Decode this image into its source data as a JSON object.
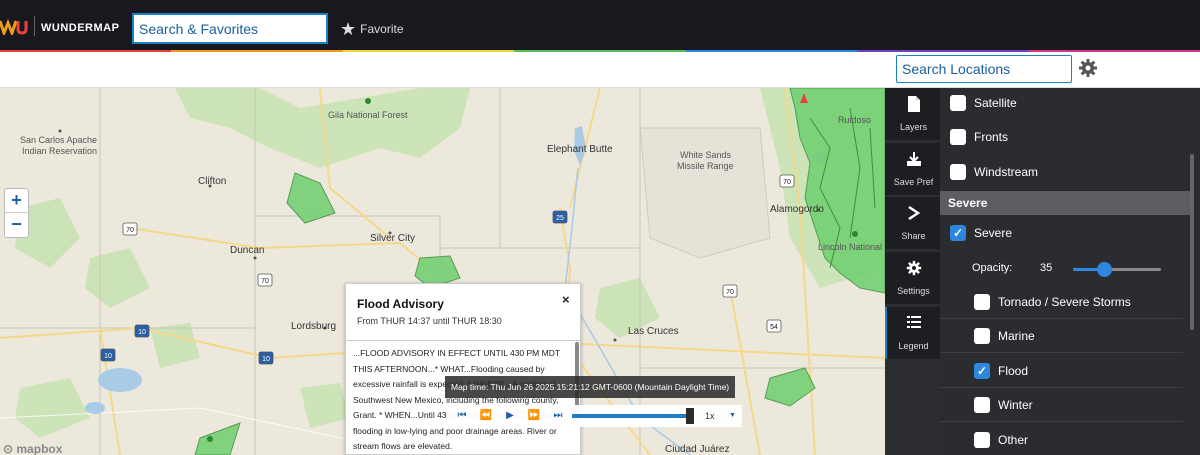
{
  "header": {
    "logo_text": "WUNDERMAP",
    "search_value": "Search & Favorites",
    "favorite_label": "Favorite"
  },
  "locbar": {
    "search_value": "Search Locations"
  },
  "map": {
    "labels": [
      {
        "text": "San Carlos Apache",
        "type": "place"
      },
      {
        "text": "Indian Reservation",
        "type": "place"
      },
      {
        "text": "Gila National Forest",
        "type": "place"
      },
      {
        "text": "Elephant Butte",
        "type": "city"
      },
      {
        "text": "White Sands",
        "type": "place"
      },
      {
        "text": "Missile Range",
        "type": "place"
      },
      {
        "text": "Clifton",
        "type": "city"
      },
      {
        "text": "Alamogordo",
        "type": "city"
      },
      {
        "text": "Duncan",
        "type": "city"
      },
      {
        "text": "Silver City",
        "type": "city"
      },
      {
        "text": "Lincoln National Fo",
        "type": "place"
      },
      {
        "text": "Lordsburg",
        "type": "city"
      },
      {
        "text": "Las Cruces",
        "type": "city"
      },
      {
        "text": "Ciudad Juárez",
        "type": "city"
      },
      {
        "text": "Ruidoso",
        "type": "city"
      }
    ],
    "shields": [
      "70",
      "70",
      "70",
      "10",
      "25",
      "10",
      "10",
      "70",
      "54"
    ],
    "mapbox": "mapbox",
    "map_time": "Map time: Thu Jun 26 2025 15:21:12 GMT-0600 (Mountain Daylight Time)",
    "speed": "1x",
    "zoom_in": "+",
    "zoom_out": "−",
    "timeline_progress": 0.98
  },
  "popup": {
    "title": "Flood Advisory",
    "close": "×",
    "subtitle": "From THUR 14:37 until THUR 18:30",
    "body": "...FLOOD ADVISORY IN EFFECT UNTIL 430 PM MDT THIS AFTERNOON...* WHAT...Flooding caused by excessive rainfall is expected. * WHERE...A portion of Southwest New Mexico, including the following county, Grant. * WHEN...Until 430 PM MDT. * IMPACTS...Minor flooding in low-lying and poor drainage areas. River or stream flows are elevated."
  },
  "tabs": [
    {
      "label": "Layers",
      "icon": "document-icon"
    },
    {
      "label": "Save Pref",
      "icon": "download-icon"
    },
    {
      "label": "Share",
      "icon": "chevron-right-icon"
    },
    {
      "label": "Settings",
      "icon": "gear-icon"
    },
    {
      "label": "Legend",
      "icon": "list-icon"
    }
  ],
  "layers": {
    "top_items": [
      {
        "label": "Satellite",
        "checked": false
      },
      {
        "label": "Fronts",
        "checked": false
      },
      {
        "label": "Windstream",
        "checked": false
      }
    ],
    "section_title": "Severe",
    "severe_item": {
      "label": "Severe",
      "checked": true
    },
    "opacity_label": "Opacity:",
    "opacity_value": "35",
    "opacity_level": 0.35,
    "sub_items": [
      {
        "label": "Tornado / Severe Storms",
        "checked": false
      },
      {
        "label": "Marine",
        "checked": false
      },
      {
        "label": "Flood",
        "checked": true
      },
      {
        "label": "Winter",
        "checked": false
      },
      {
        "label": "Other",
        "checked": false
      }
    ]
  },
  "colors": {
    "accent": "#1d7fc4",
    "header_bg": "#17191e",
    "panel_bg": "#2b2c30",
    "checked": "#2e86de",
    "flood_green": "#6fcf6f",
    "rainbow": [
      "#e8423c",
      "#f29c1f",
      "#f3d33a",
      "#5cb85c",
      "#2e86de",
      "#6f42c1",
      "#d63384"
    ]
  }
}
